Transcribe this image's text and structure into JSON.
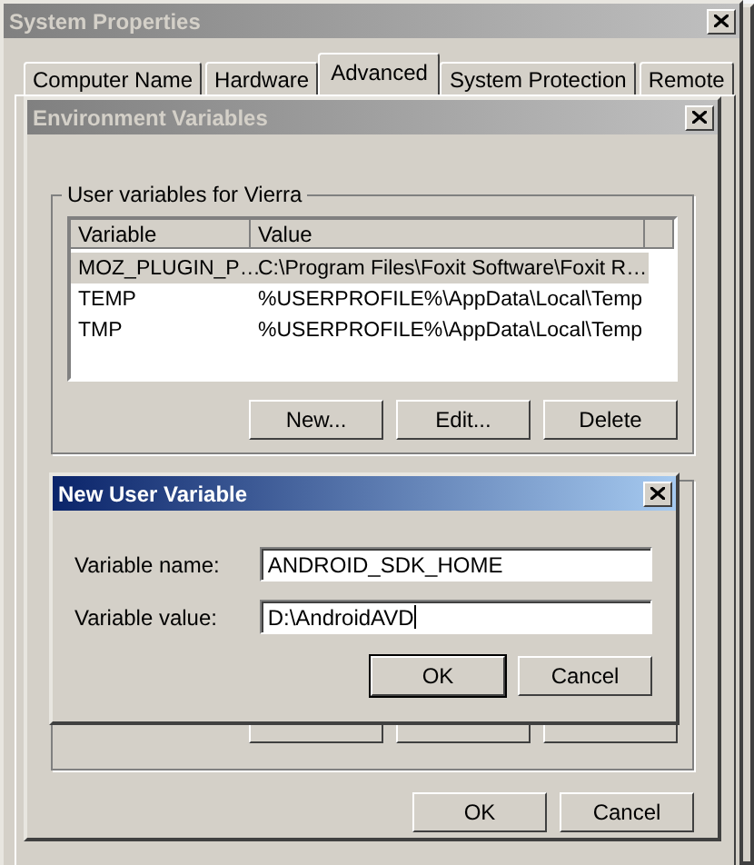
{
  "system_properties": {
    "title": "System Properties",
    "tabs": [
      {
        "label": "Computer Name",
        "selected": false
      },
      {
        "label": "Hardware",
        "selected": false
      },
      {
        "label": "Advanced",
        "selected": true
      },
      {
        "label": "System Protection",
        "selected": false
      },
      {
        "label": "Remote",
        "selected": false
      }
    ]
  },
  "environment_variables": {
    "title": "Environment Variables",
    "user_variables": {
      "label": "User variables for Vierra",
      "columns": [
        "Variable",
        "Value"
      ],
      "rows": [
        {
          "variable": "MOZ_PLUGIN_P…",
          "value": "C:\\Program Files\\Foxit Software\\Foxit R…",
          "selected": true
        },
        {
          "variable": "TEMP",
          "value": "%USERPROFILE%\\AppData\\Local\\Temp",
          "selected": false
        },
        {
          "variable": "TMP",
          "value": "%USERPROFILE%\\AppData\\Local\\Temp",
          "selected": false
        }
      ],
      "buttons": [
        "New...",
        "Edit...",
        "Delete"
      ]
    },
    "buttons": [
      "OK",
      "Cancel"
    ]
  },
  "new_user_variable": {
    "title": "New User Variable",
    "fields": [
      {
        "label": "Variable name:",
        "value": "ANDROID_SDK_HOME",
        "focused": false
      },
      {
        "label": "Variable value:",
        "value": "D:\\AndroidAVD",
        "focused": true
      }
    ],
    "buttons": [
      {
        "label": "OK",
        "default": true
      },
      {
        "label": "Cancel",
        "default": false
      }
    ]
  }
}
